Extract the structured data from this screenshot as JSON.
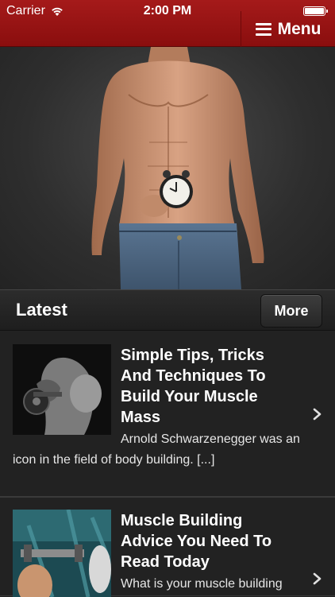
{
  "status_bar": {
    "carrier": "Carrier",
    "time": "2:00 PM"
  },
  "header": {
    "menu_label": "Menu"
  },
  "latest": {
    "title": "Latest",
    "more_label": "More"
  },
  "articles": [
    {
      "title": "Simple Tips, Tricks And Techniques To Build Your Muscle Mass",
      "excerpt": "Arnold Schwarzenegger was an icon in the field of body building. [...]"
    },
    {
      "title": "Muscle Building Advice You Need To Read Today",
      "excerpt": "What is your muscle building"
    }
  ],
  "colors": {
    "header": "#9a1414",
    "background": "#222222",
    "text": "#ffffff"
  },
  "icons": [
    "wifi-icon",
    "battery-icon",
    "hamburger-icon",
    "chevron-right-icon"
  ]
}
